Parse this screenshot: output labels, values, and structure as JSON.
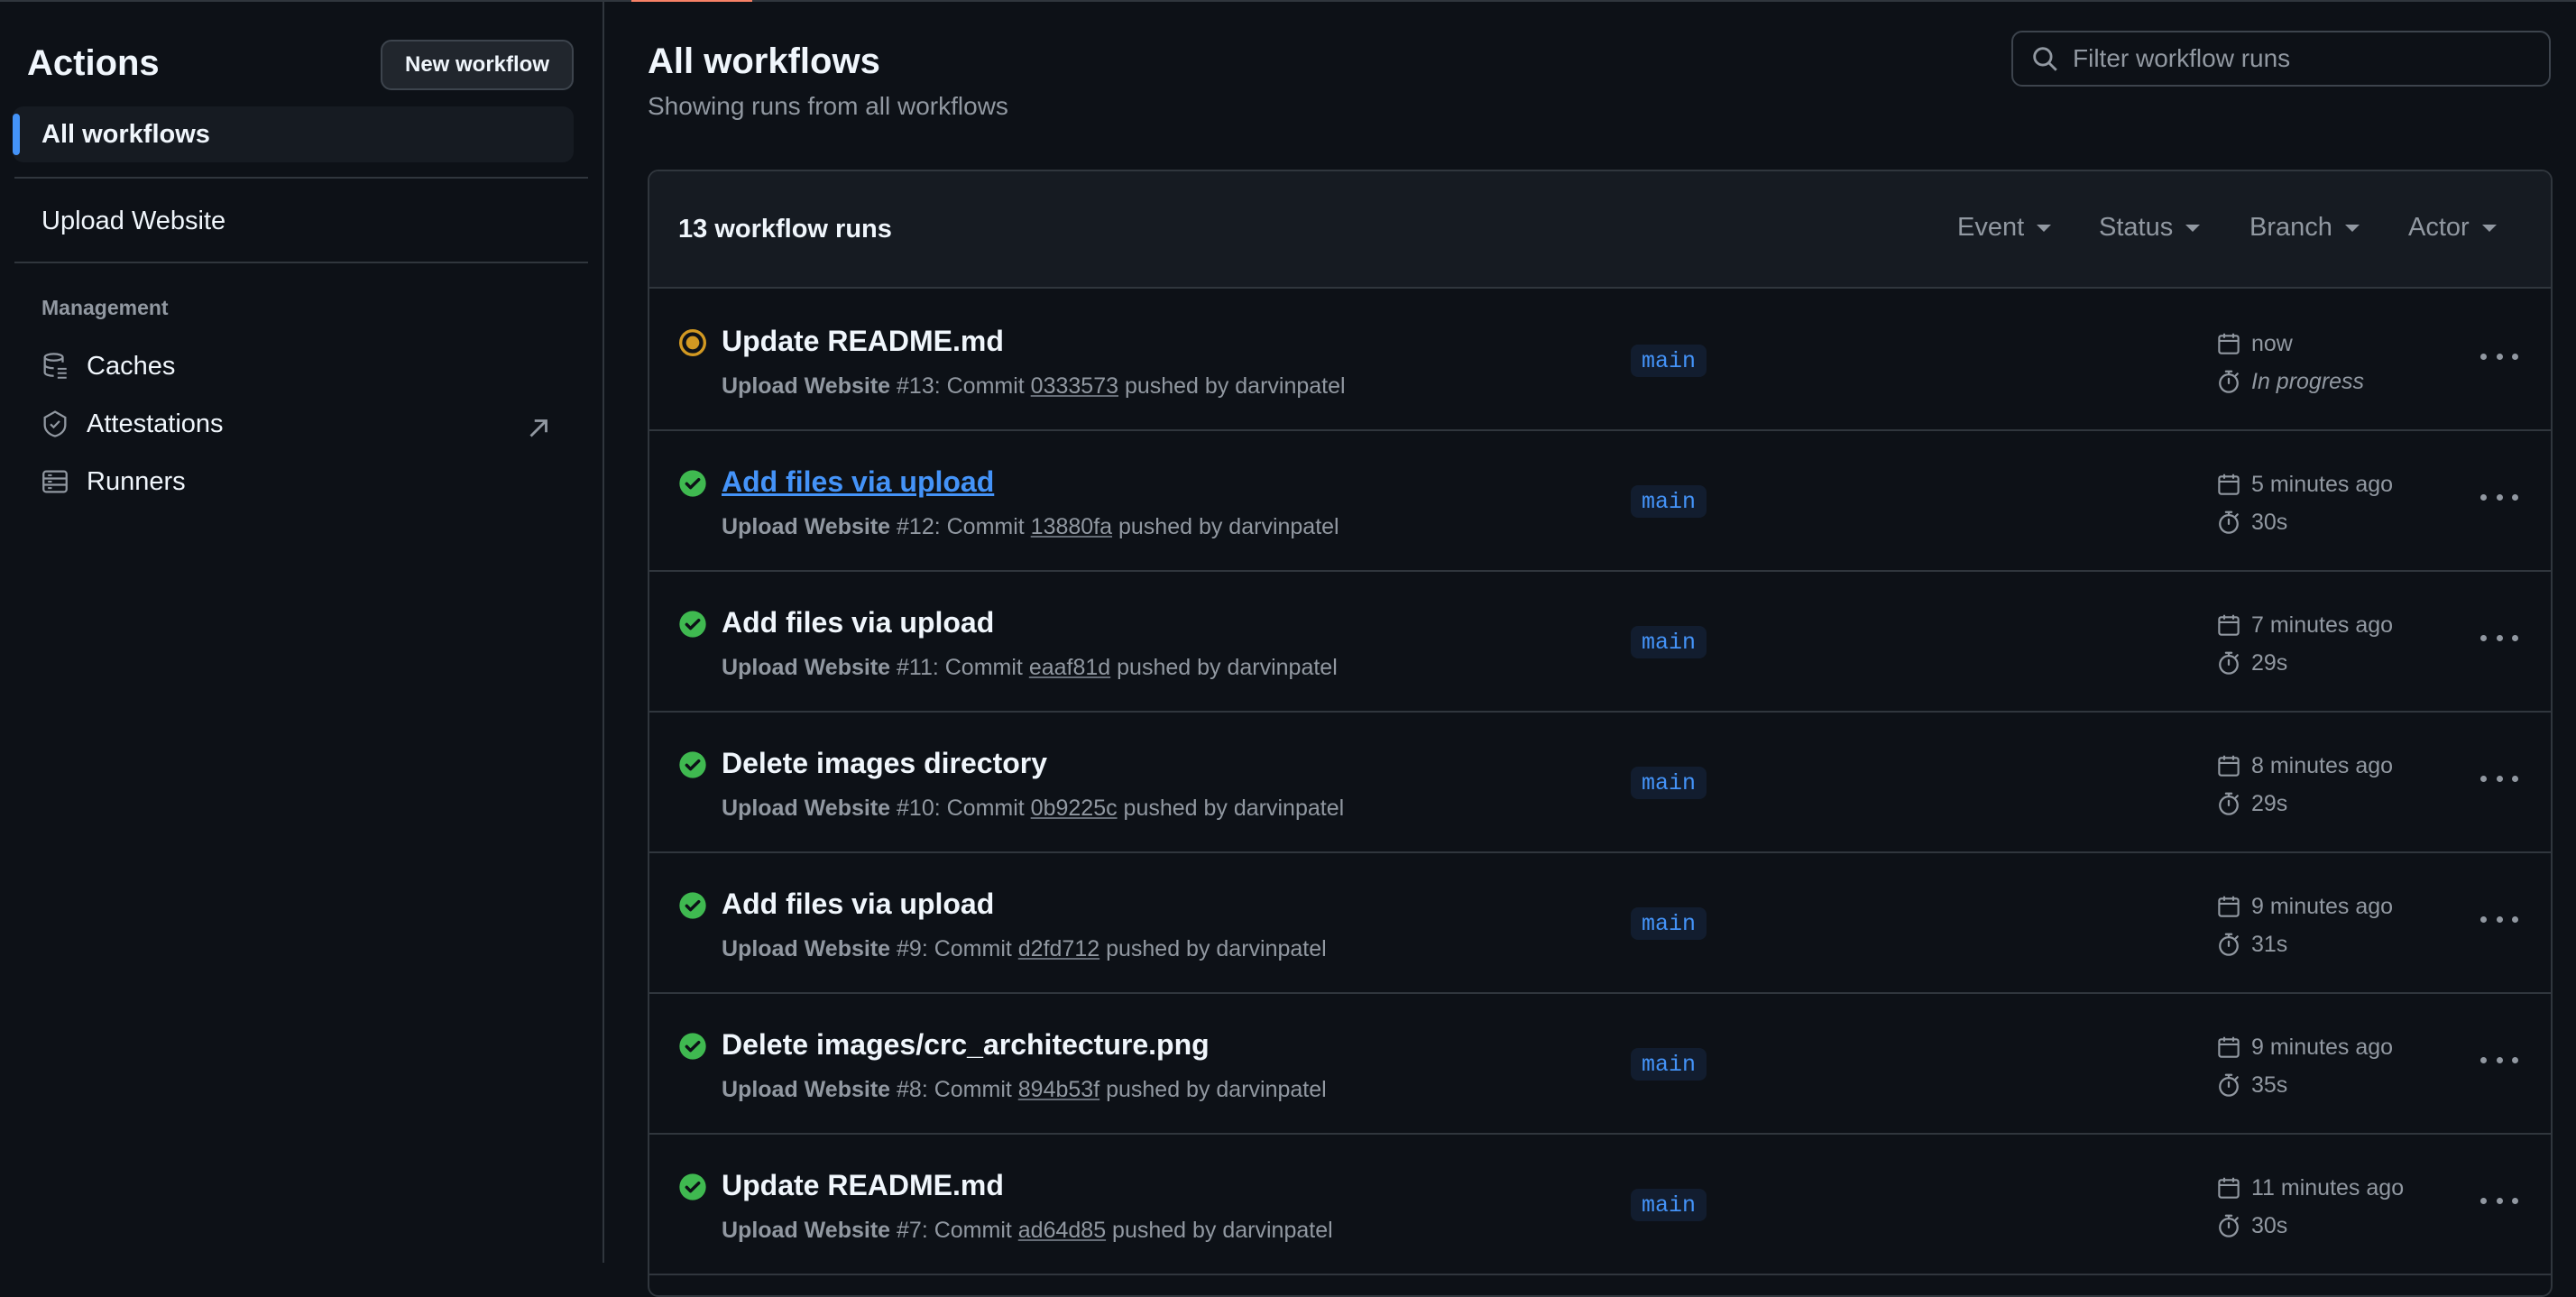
{
  "sidebar": {
    "title": "Actions",
    "new_workflow_label": "New workflow",
    "all_workflows_label": "All workflows",
    "workflows": [
      "Upload Website"
    ],
    "management_heading": "Management",
    "management_items": [
      {
        "label": "Caches",
        "icon": "database-icon"
      },
      {
        "label": "Attestations",
        "icon": "shield-check-icon",
        "external": true
      },
      {
        "label": "Runners",
        "icon": "server-icon"
      }
    ]
  },
  "main": {
    "title": "All workflows",
    "subtitle": "Showing runs from all workflows",
    "filter_placeholder": "Filter workflow runs",
    "runs_count": "13 workflow runs",
    "filters": [
      "Event",
      "Status",
      "Branch",
      "Actor"
    ]
  },
  "colors": {
    "background": "#0d1117",
    "accent_blue": "#4493f8",
    "success_green": "#3fb950",
    "in_progress_yellow": "#d29922"
  },
  "runs": [
    {
      "title": "Update README.md",
      "workflow": "Upload Website",
      "number": "#13",
      "commit": "0333573",
      "pusher": "darvinpatel",
      "branch": "main",
      "when": "now",
      "duration": "In progress",
      "status": "in_progress",
      "link": false
    },
    {
      "title": "Add files via upload",
      "workflow": "Upload Website",
      "number": "#12",
      "commit": "13880fa",
      "pusher": "darvinpatel",
      "branch": "main",
      "when": "5 minutes ago",
      "duration": "30s",
      "status": "success",
      "link": true
    },
    {
      "title": "Add files via upload",
      "workflow": "Upload Website",
      "number": "#11",
      "commit": "eaaf81d",
      "pusher": "darvinpatel",
      "branch": "main",
      "when": "7 minutes ago",
      "duration": "29s",
      "status": "success",
      "link": false
    },
    {
      "title": "Delete images directory",
      "workflow": "Upload Website",
      "number": "#10",
      "commit": "0b9225c",
      "pusher": "darvinpatel",
      "branch": "main",
      "when": "8 minutes ago",
      "duration": "29s",
      "status": "success",
      "link": false
    },
    {
      "title": "Add files via upload",
      "workflow": "Upload Website",
      "number": "#9",
      "commit": "d2fd712",
      "pusher": "darvinpatel",
      "branch": "main",
      "when": "9 minutes ago",
      "duration": "31s",
      "status": "success",
      "link": false
    },
    {
      "title": "Delete images/crc_architecture.png",
      "workflow": "Upload Website",
      "number": "#8",
      "commit": "894b53f",
      "pusher": "darvinpatel",
      "branch": "main",
      "when": "9 minutes ago",
      "duration": "35s",
      "status": "success",
      "link": false
    },
    {
      "title": "Update README.md",
      "workflow": "Upload Website",
      "number": "#7",
      "commit": "ad64d85",
      "pusher": "darvinpatel",
      "branch": "main",
      "when": "11 minutes ago",
      "duration": "30s",
      "status": "success",
      "link": false
    }
  ],
  "strings": {
    "commit_prefix": ": Commit ",
    "pushed_by": " pushed by "
  }
}
